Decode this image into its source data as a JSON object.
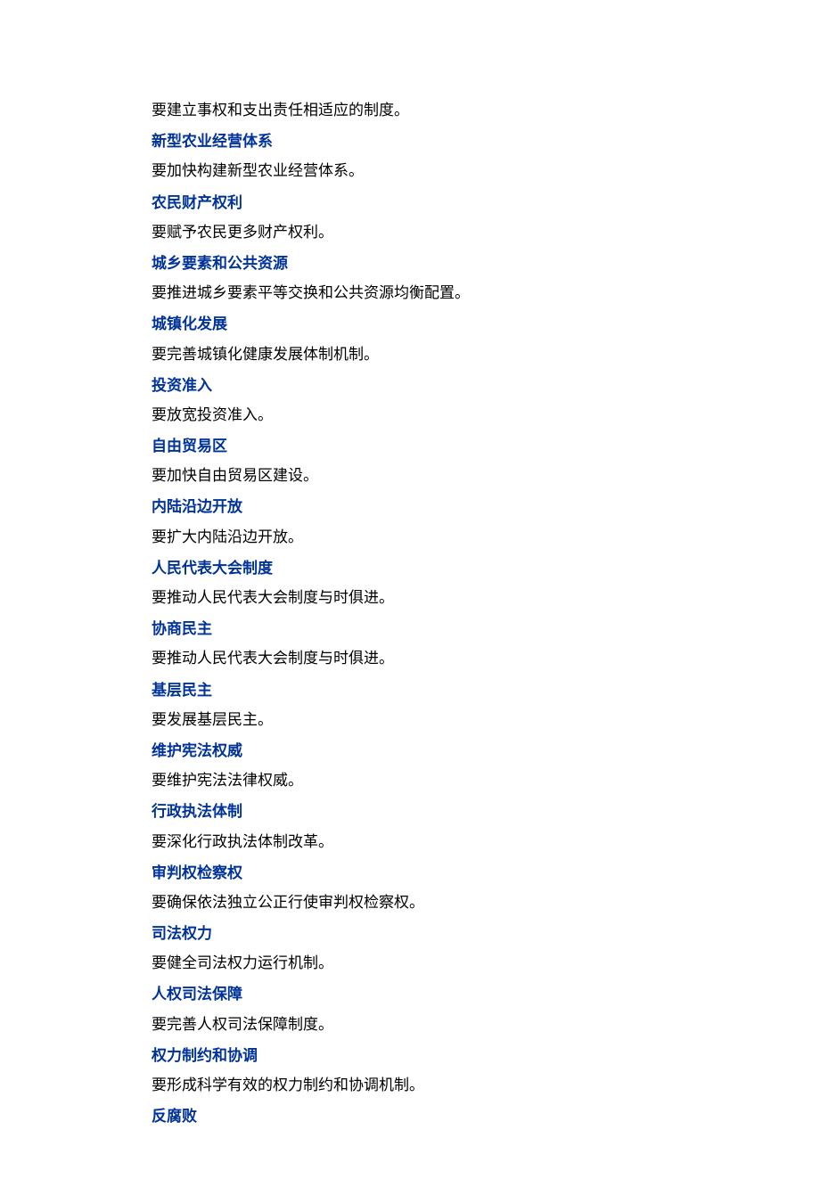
{
  "items": [
    {
      "heading": null,
      "body": "要建立事权和支出责任相适应的制度。"
    },
    {
      "heading": "新型农业经营体系",
      "body": "要加快构建新型农业经营体系。"
    },
    {
      "heading": "农民财产权利",
      "body": "要赋予农民更多财产权利。"
    },
    {
      "heading": "城乡要素和公共资源",
      "body": "要推进城乡要素平等交换和公共资源均衡配置。"
    },
    {
      "heading": "城镇化发展",
      "body": "要完善城镇化健康发展体制机制。"
    },
    {
      "heading": "投资准入",
      "body": "要放宽投资准入。"
    },
    {
      "heading": "自由贸易区",
      "body": "要加快自由贸易区建设。"
    },
    {
      "heading": "内陆沿边开放",
      "body": "要扩大内陆沿边开放。"
    },
    {
      "heading": "人民代表大会制度",
      "body": "要推动人民代表大会制度与时俱进。"
    },
    {
      "heading": "协商民主",
      "body": "要推动人民代表大会制度与时俱进。"
    },
    {
      "heading": "基层民主",
      "body": "要发展基层民主。"
    },
    {
      "heading": "维护宪法权威",
      "body": "要维护宪法法律权威。"
    },
    {
      "heading": "行政执法体制",
      "body": "要深化行政执法体制改革。"
    },
    {
      "heading": "审判权检察权",
      "body": "要确保依法独立公正行使审判权检察权。"
    },
    {
      "heading": "司法权力",
      "body": "要健全司法权力运行机制。"
    },
    {
      "heading": "人权司法保障",
      "body": "要完善人权司法保障制度。"
    },
    {
      "heading": "权力制约和协调",
      "body": "要形成科学有效的权力制约和协调机制。"
    },
    {
      "heading": "反腐败",
      "body": null
    }
  ]
}
